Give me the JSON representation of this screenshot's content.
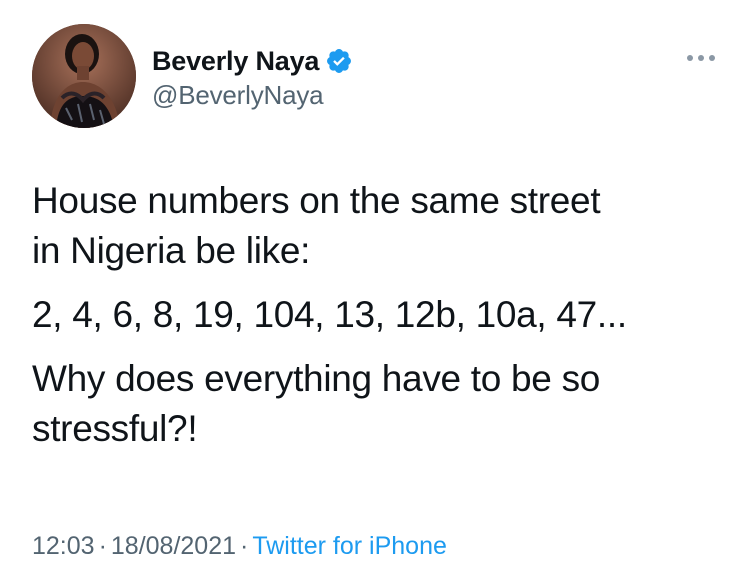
{
  "author": {
    "display_name": "Beverly Naya",
    "handle": "@BeverlyNaya",
    "verified_icon": "verified-badge-icon",
    "verified_color": "#1d9bf0"
  },
  "menu": {
    "icon": "more-options-icon"
  },
  "tweet": {
    "paragraphs": [
      "House numbers on the same street\nin Nigeria be like:",
      "2, 4, 6, 8, 19, 104, 13, 12b, 10a, 47...",
      "Why does everything have to be so\nstressful?!"
    ]
  },
  "meta": {
    "time": "12:03",
    "separator": "·",
    "date": "18/08/2021",
    "source": "Twitter for iPhone"
  },
  "colors": {
    "text": "#0f1419",
    "secondary": "#536471",
    "accent": "#1d9bf0"
  }
}
